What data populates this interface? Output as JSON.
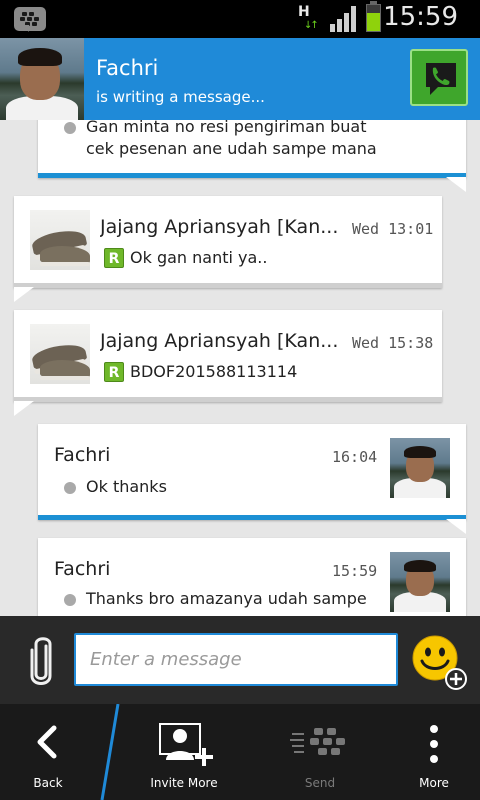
{
  "status_bar": {
    "network": "H",
    "time": "15:59"
  },
  "header": {
    "contact_name": "Fachri",
    "contact_status": "is writing a message..."
  },
  "messages": [
    {
      "id": "m0",
      "from": "me",
      "lines": [
        "Gan minta no resi pengiriman buat",
        "cek pesenan ane udah sampe mana"
      ]
    },
    {
      "id": "m1",
      "from": "them",
      "name": "Jajang Apriansyah [Kan...",
      "time": "Wed 13:01",
      "text": "Ok gan nanti ya..",
      "badge": "R"
    },
    {
      "id": "m2",
      "from": "them",
      "name": "Jajang Apriansyah [Kan...",
      "time": "Wed 15:38",
      "text": "BDOF201588113114",
      "badge": "R"
    },
    {
      "id": "m3",
      "from": "me",
      "name": "Fachri",
      "time": "16:04",
      "text": "Ok thanks"
    },
    {
      "id": "m4",
      "from": "me",
      "name": "Fachri",
      "time": "15:59",
      "text": "Thanks bro amazanya udah sampe"
    }
  ],
  "composer": {
    "placeholder": "Enter a message"
  },
  "nav": {
    "back": "Back",
    "invite_more": "Invite More",
    "send": "Send",
    "more": "More"
  },
  "colors": {
    "header_blue": "#1f8ad8",
    "call_green": "#3fa62c",
    "delivered_bar": "#1c90d4",
    "read_badge": "#6fb82a"
  },
  "icons": {
    "status_app": "bbm-icon",
    "call": "phone-icon",
    "attach": "paperclip-icon",
    "emoticon": "smiley-plus-icon",
    "back": "chevron-left-icon",
    "invite": "add-contact-icon",
    "send": "bbm-send-icon",
    "more": "vertical-dots-icon"
  }
}
